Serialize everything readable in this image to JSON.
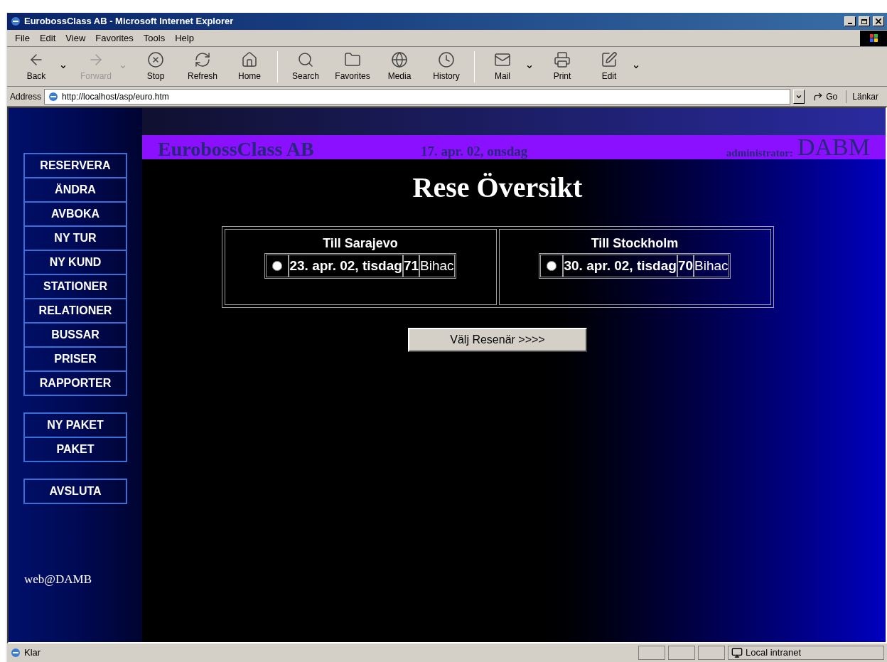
{
  "window": {
    "title": "EurobossClass AB - Microsoft Internet Explorer"
  },
  "menu": [
    "File",
    "Edit",
    "View",
    "Favorites",
    "Tools",
    "Help"
  ],
  "toolbar": [
    {
      "label": "Back",
      "disabled": false,
      "dropdown": true
    },
    {
      "label": "Forward",
      "disabled": true,
      "dropdown": true
    },
    {
      "label": "Stop",
      "disabled": false,
      "dropdown": false
    },
    {
      "label": "Refresh",
      "disabled": false,
      "dropdown": false
    },
    {
      "label": "Home",
      "disabled": false,
      "dropdown": false
    },
    {
      "label": "Search",
      "disabled": false,
      "dropdown": false
    },
    {
      "label": "Favorites",
      "disabled": false,
      "dropdown": false
    },
    {
      "label": "Media",
      "disabled": false,
      "dropdown": false
    },
    {
      "label": "History",
      "disabled": false,
      "dropdown": false
    },
    {
      "label": "Mail",
      "disabled": false,
      "dropdown": true
    },
    {
      "label": "Print",
      "disabled": false,
      "dropdown": false
    },
    {
      "label": "Edit",
      "disabled": false,
      "dropdown": true
    }
  ],
  "address": {
    "label": "Address",
    "url": "http://localhost/asp/euro.htm",
    "go": "Go",
    "links": "Länkar"
  },
  "page": {
    "sidebar": {
      "groups": [
        [
          "RESERVERA",
          "ÄNDRA",
          "AVBOKA",
          "NY TUR",
          "NY KUND",
          "STATIONER",
          "RELATIONER",
          "BUSSAR",
          "PRISER",
          "RAPPORTER"
        ],
        [
          "NY PAKET",
          "PAKET"
        ],
        [
          "AVSLUTA"
        ]
      ],
      "footer": "web@DAMB"
    },
    "header": {
      "company": "EurobossClass AB",
      "date": "17. apr. 02, onsdag",
      "admin_label": "administrator:",
      "admin_name": "DABM"
    },
    "heading": "Rese Översikt",
    "trips": [
      {
        "title": "Till Sarajevo",
        "options": [
          {
            "date": "23. apr. 02, tisdag",
            "number": "71",
            "place": "Bihac",
            "selected": false
          }
        ]
      },
      {
        "title": "Till Stockholm",
        "options": [
          {
            "date": "30. apr. 02, tisdag",
            "number": "70",
            "place": "Bihac",
            "selected": false
          }
        ]
      }
    ],
    "button": "Välj Resenär >>>>"
  },
  "status": {
    "text": "Klar",
    "zone": "Local intranet"
  }
}
